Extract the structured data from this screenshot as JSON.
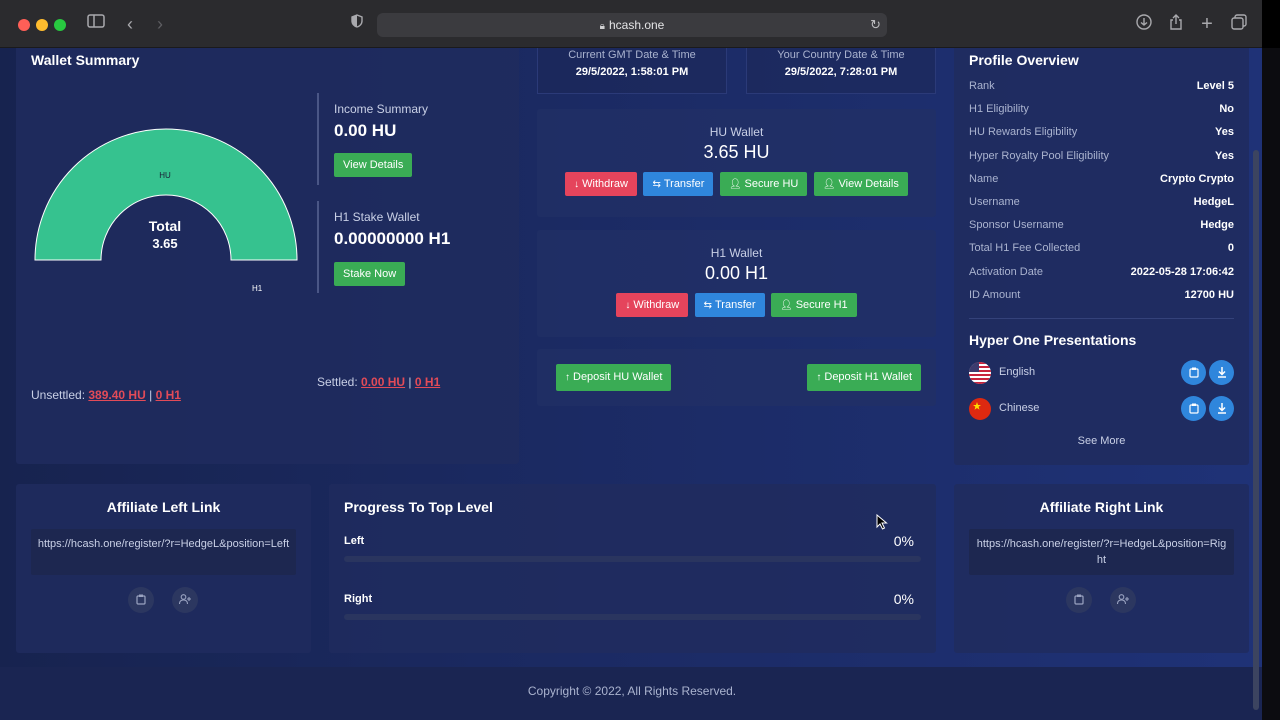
{
  "browser": {
    "url": "hcash.one"
  },
  "wallet_summary": {
    "title": "Wallet Summary",
    "gauge": {
      "segment_label": "HU",
      "end_label": "H1",
      "total_label": "Total",
      "total_value": "3.65"
    },
    "income": {
      "label": "Income Summary",
      "value": "0.00 HU",
      "button": "View Details"
    },
    "stake": {
      "label": "H1 Stake Wallet",
      "value": "0.00000000 H1",
      "button": "Stake Now"
    },
    "unsettled": {
      "label": "Unsettled:",
      "hu": "389.40 HU",
      "sep": "|",
      "h1": "0 H1"
    },
    "settled": {
      "label": "Settled:",
      "hu": "0.00 HU",
      "sep": "|",
      "h1": "0 H1"
    },
    "gauge_color": "#36c28f"
  },
  "dates": {
    "gmt_label": "Current GMT Date & Time",
    "gmt_value": "29/5/2022, 1:58:01 PM",
    "local_label": "Your Country Date & Time",
    "local_value": "29/5/2022, 7:28:01 PM"
  },
  "hu_wallet": {
    "name": "HU Wallet",
    "value": "3.65 HU",
    "buttons": {
      "withdraw": "Withdraw",
      "transfer": "Transfer",
      "secure": "Secure HU",
      "details": "View Details"
    }
  },
  "h1_wallet": {
    "name": "H1 Wallet",
    "value": "0.00 H1",
    "buttons": {
      "withdraw": "Withdraw",
      "transfer": "Transfer",
      "secure": "Secure H1"
    }
  },
  "deposits": {
    "hu": "Deposit HU Wallet",
    "h1": "Deposit H1 Wallet"
  },
  "profile": {
    "title": "Profile Overview",
    "rows": [
      {
        "k": "Rank",
        "v": "Level 5"
      },
      {
        "k": "H1 Eligibility",
        "v": "No"
      },
      {
        "k": "HU Rewards Eligibility",
        "v": "Yes"
      },
      {
        "k": "Hyper Royalty Pool Eligibility",
        "v": "Yes"
      },
      {
        "k": "Name",
        "v": "Crypto Crypto"
      },
      {
        "k": "Username",
        "v": "HedgeL"
      },
      {
        "k": "Sponsor Username",
        "v": "Hedge"
      },
      {
        "k": "Total H1 Fee Collected",
        "v": "0"
      },
      {
        "k": "Activation Date",
        "v": "2022-05-28 17:06:42"
      },
      {
        "k": "ID Amount",
        "v": "12700 HU"
      }
    ],
    "presentations_title": "Hyper One Presentations",
    "languages": [
      "English",
      "Chinese"
    ],
    "see_more": "See More"
  },
  "affiliate_left": {
    "title": "Affiliate Left Link",
    "link": "https://hcash.one/register/?r=HedgeL&position=Left"
  },
  "affiliate_right": {
    "title": "Affiliate Right Link",
    "link": "https://hcash.one/register/?r=HedgeL&position=Right"
  },
  "progress": {
    "title": "Progress To Top Level",
    "left_label": "Left",
    "left_value": "0%",
    "right_label": "Right",
    "right_value": "0%"
  },
  "footer": {
    "copyright": "Copyright © 2022, All Rights Reserved."
  }
}
